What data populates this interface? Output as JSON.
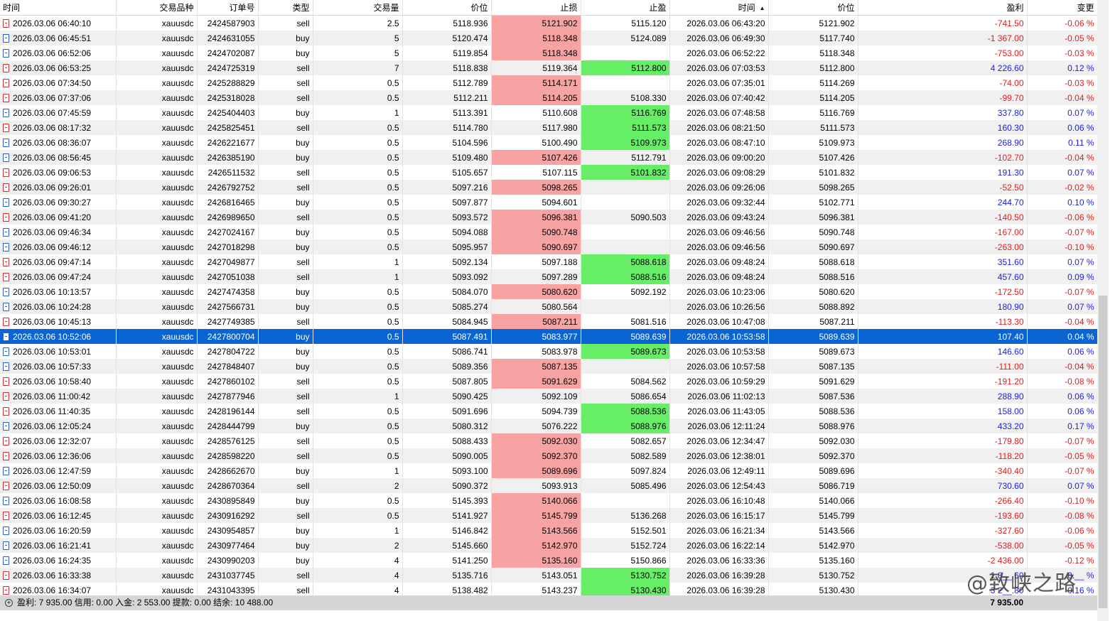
{
  "columns": [
    "时间",
    "交易品种",
    "订单号",
    "类型",
    "交易量",
    "价位",
    "止损",
    "止盈",
    "时间",
    "价位",
    "盈利",
    "变更"
  ],
  "sort_indicator": "▲",
  "colors": {
    "selected": "#0a64d2",
    "sl_hit": "#f8a3a3",
    "tp_hit": "#66ee66",
    "negative": "#e11d1d",
    "positive": "#1d1de1"
  },
  "rows": [
    {
      "time": "2026.03.06 06:40:10",
      "symbol": "xauusdc",
      "ticket": "2424587903",
      "type": "sell",
      "volume": "2.5",
      "price": "5118.936",
      "sl": "5121.902",
      "tp": "5115.120",
      "close_time": "2026.03.06 06:43:20",
      "close_price": "5121.902",
      "profit": "-741.50",
      "change": "-0.06 %",
      "hit": "sl"
    },
    {
      "time": "2026.03.06 06:45:51",
      "symbol": "xauusdc",
      "ticket": "2424631055",
      "type": "buy",
      "volume": "5",
      "price": "5120.474",
      "sl": "5118.348",
      "tp": "5124.089",
      "close_time": "2026.03.06 06:49:30",
      "close_price": "5117.740",
      "profit": "-1 367.00",
      "change": "-0.05 %",
      "hit": "sl"
    },
    {
      "time": "2026.03.06 06:52:06",
      "symbol": "xauusdc",
      "ticket": "2424702087",
      "type": "buy",
      "volume": "5",
      "price": "5119.854",
      "sl": "5118.348",
      "tp": "",
      "close_time": "2026.03.06 06:52:22",
      "close_price": "5118.348",
      "profit": "-753.00",
      "change": "-0.03 %",
      "hit": "sl"
    },
    {
      "time": "2026.03.06 06:53:25",
      "symbol": "xauusdc",
      "ticket": "2424725319",
      "type": "sell",
      "volume": "7",
      "price": "5118.838",
      "sl": "5119.364",
      "tp": "5112.800",
      "close_time": "2026.03.06 07:03:53",
      "close_price": "5112.800",
      "profit": "4 226.60",
      "change": "0.12 %",
      "hit": "tp"
    },
    {
      "time": "2026.03.06 07:34:50",
      "symbol": "xauusdc",
      "ticket": "2425288829",
      "type": "sell",
      "volume": "0.5",
      "price": "5112.789",
      "sl": "5114.171",
      "tp": "",
      "close_time": "2026.03.06 07:35:01",
      "close_price": "5114.269",
      "profit": "-74.00",
      "change": "-0.03 %",
      "hit": "sl"
    },
    {
      "time": "2026.03.06 07:37:06",
      "symbol": "xauusdc",
      "ticket": "2425318028",
      "type": "sell",
      "volume": "0.5",
      "price": "5112.211",
      "sl": "5114.205",
      "tp": "5108.330",
      "close_time": "2026.03.06 07:40:42",
      "close_price": "5114.205",
      "profit": "-99.70",
      "change": "-0.04 %",
      "hit": "sl"
    },
    {
      "time": "2026.03.06 07:45:59",
      "symbol": "xauusdc",
      "ticket": "2425404403",
      "type": "buy",
      "volume": "1",
      "price": "5113.391",
      "sl": "5110.608",
      "tp": "5116.769",
      "close_time": "2026.03.06 07:48:58",
      "close_price": "5116.769",
      "profit": "337.80",
      "change": "0.07 %",
      "hit": "tp"
    },
    {
      "time": "2026.03.06 08:17:32",
      "symbol": "xauusdc",
      "ticket": "2425825451",
      "type": "sell",
      "volume": "0.5",
      "price": "5114.780",
      "sl": "5117.980",
      "tp": "5111.573",
      "close_time": "2026.03.06 08:21:50",
      "close_price": "5111.573",
      "profit": "160.30",
      "change": "0.06 %",
      "hit": "tp"
    },
    {
      "time": "2026.03.06 08:36:07",
      "symbol": "xauusdc",
      "ticket": "2426221677",
      "type": "buy",
      "volume": "0.5",
      "price": "5104.596",
      "sl": "5100.490",
      "tp": "5109.973",
      "close_time": "2026.03.06 08:47:10",
      "close_price": "5109.973",
      "profit": "268.90",
      "change": "0.11 %",
      "hit": "tp"
    },
    {
      "time": "2026.03.06 08:56:45",
      "symbol": "xauusdc",
      "ticket": "2426385190",
      "type": "buy",
      "volume": "0.5",
      "price": "5109.480",
      "sl": "5107.426",
      "tp": "5112.791",
      "close_time": "2026.03.06 09:00:20",
      "close_price": "5107.426",
      "profit": "-102.70",
      "change": "-0.04 %",
      "hit": "sl"
    },
    {
      "time": "2026.03.06 09:06:53",
      "symbol": "xauusdc",
      "ticket": "2426511532",
      "type": "sell",
      "volume": "0.5",
      "price": "5105.657",
      "sl": "5107.115",
      "tp": "5101.832",
      "close_time": "2026.03.06 09:08:29",
      "close_price": "5101.832",
      "profit": "191.30",
      "change": "0.07 %",
      "hit": "tp"
    },
    {
      "time": "2026.03.06 09:26:01",
      "symbol": "xauusdc",
      "ticket": "2426792752",
      "type": "sell",
      "volume": "0.5",
      "price": "5097.216",
      "sl": "5098.265",
      "tp": "",
      "close_time": "2026.03.06 09:26:06",
      "close_price": "5098.265",
      "profit": "-52.50",
      "change": "-0.02 %",
      "hit": "sl"
    },
    {
      "time": "2026.03.06 09:30:27",
      "symbol": "xauusdc",
      "ticket": "2426816465",
      "type": "buy",
      "volume": "0.5",
      "price": "5097.877",
      "sl": "5094.601",
      "tp": "",
      "close_time": "2026.03.06 09:32:44",
      "close_price": "5102.771",
      "profit": "244.70",
      "change": "0.10 %",
      "hit": ""
    },
    {
      "time": "2026.03.06 09:41:20",
      "symbol": "xauusdc",
      "ticket": "2426989650",
      "type": "sell",
      "volume": "0.5",
      "price": "5093.572",
      "sl": "5096.381",
      "tp": "5090.503",
      "close_time": "2026.03.06 09:43:24",
      "close_price": "5096.381",
      "profit": "-140.50",
      "change": "-0.06 %",
      "hit": "sl"
    },
    {
      "time": "2026.03.06 09:46:34",
      "symbol": "xauusdc",
      "ticket": "2427024167",
      "type": "buy",
      "volume": "0.5",
      "price": "5094.088",
      "sl": "5090.748",
      "tp": "",
      "close_time": "2026.03.06 09:46:56",
      "close_price": "5090.748",
      "profit": "-167.00",
      "change": "-0.07 %",
      "hit": "sl"
    },
    {
      "time": "2026.03.06 09:46:12",
      "symbol": "xauusdc",
      "ticket": "2427018298",
      "type": "buy",
      "volume": "0.5",
      "price": "5095.957",
      "sl": "5090.697",
      "tp": "",
      "close_time": "2026.03.06 09:46:56",
      "close_price": "5090.697",
      "profit": "-263.00",
      "change": "-0.10 %",
      "hit": "sl"
    },
    {
      "time": "2026.03.06 09:47:14",
      "symbol": "xauusdc",
      "ticket": "2427049877",
      "type": "sell",
      "volume": "1",
      "price": "5092.134",
      "sl": "5097.188",
      "tp": "5088.618",
      "close_time": "2026.03.06 09:48:24",
      "close_price": "5088.618",
      "profit": "351.60",
      "change": "0.07 %",
      "hit": "tp"
    },
    {
      "time": "2026.03.06 09:47:24",
      "symbol": "xauusdc",
      "ticket": "2427051038",
      "type": "sell",
      "volume": "1",
      "price": "5093.092",
      "sl": "5097.289",
      "tp": "5088.516",
      "close_time": "2026.03.06 09:48:24",
      "close_price": "5088.516",
      "profit": "457.60",
      "change": "0.09 %",
      "hit": "tp"
    },
    {
      "time": "2026.03.06 10:13:57",
      "symbol": "xauusdc",
      "ticket": "2427474358",
      "type": "buy",
      "volume": "0.5",
      "price": "5084.070",
      "sl": "5080.620",
      "tp": "5092.192",
      "close_time": "2026.03.06 10:23:06",
      "close_price": "5080.620",
      "profit": "-172.50",
      "change": "-0.07 %",
      "hit": "sl"
    },
    {
      "time": "2026.03.06 10:24:28",
      "symbol": "xauusdc",
      "ticket": "2427566731",
      "type": "buy",
      "volume": "0.5",
      "price": "5085.274",
      "sl": "5080.564",
      "tp": "",
      "close_time": "2026.03.06 10:26:56",
      "close_price": "5088.892",
      "profit": "180.90",
      "change": "0.07 %",
      "hit": ""
    },
    {
      "time": "2026.03.06 10:45:13",
      "symbol": "xauusdc",
      "ticket": "2427749385",
      "type": "sell",
      "volume": "0.5",
      "price": "5084.945",
      "sl": "5087.211",
      "tp": "5081.516",
      "close_time": "2026.03.06 10:47:08",
      "close_price": "5087.211",
      "profit": "-113.30",
      "change": "-0.04 %",
      "hit": "sl"
    },
    {
      "time": "2026.03.06 10:52:06",
      "symbol": "xauusdc",
      "ticket": "2427800704",
      "type": "buy",
      "volume": "0.5",
      "price": "5087.491",
      "sl": "5083.977",
      "tp": "5089.639",
      "close_time": "2026.03.06 10:53:58",
      "close_price": "5089.639",
      "profit": "107.40",
      "change": "0.04 %",
      "hit": "",
      "selected": true
    },
    {
      "time": "2026.03.06 10:53:01",
      "symbol": "xauusdc",
      "ticket": "2427804722",
      "type": "buy",
      "volume": "0.5",
      "price": "5086.741",
      "sl": "5083.978",
      "tp": "5089.673",
      "close_time": "2026.03.06 10:53:58",
      "close_price": "5089.673",
      "profit": "146.60",
      "change": "0.06 %",
      "hit": "tp"
    },
    {
      "time": "2026.03.06 10:57:33",
      "symbol": "xauusdc",
      "ticket": "2427848407",
      "type": "buy",
      "volume": "0.5",
      "price": "5089.356",
      "sl": "5087.135",
      "tp": "",
      "close_time": "2026.03.06 10:57:58",
      "close_price": "5087.135",
      "profit": "-111.00",
      "change": "-0.04 %",
      "hit": "sl"
    },
    {
      "time": "2026.03.06 10:58:40",
      "symbol": "xauusdc",
      "ticket": "2427860102",
      "type": "sell",
      "volume": "0.5",
      "price": "5087.805",
      "sl": "5091.629",
      "tp": "5084.562",
      "close_time": "2026.03.06 10:59:29",
      "close_price": "5091.629",
      "profit": "-191.20",
      "change": "-0.08 %",
      "hit": "sl"
    },
    {
      "time": "2026.03.06 11:00:42",
      "symbol": "xauusdc",
      "ticket": "2427877946",
      "type": "sell",
      "volume": "1",
      "price": "5090.425",
      "sl": "5092.109",
      "tp": "5086.654",
      "close_time": "2026.03.06 11:02:13",
      "close_price": "5087.536",
      "profit": "288.90",
      "change": "0.06 %",
      "hit": ""
    },
    {
      "time": "2026.03.06 11:40:35",
      "symbol": "xauusdc",
      "ticket": "2428196144",
      "type": "sell",
      "volume": "0.5",
      "price": "5091.696",
      "sl": "5094.739",
      "tp": "5088.536",
      "close_time": "2026.03.06 11:43:05",
      "close_price": "5088.536",
      "profit": "158.00",
      "change": "0.06 %",
      "hit": "tp"
    },
    {
      "time": "2026.03.06 12:05:24",
      "symbol": "xauusdc",
      "ticket": "2428444799",
      "type": "buy",
      "volume": "0.5",
      "price": "5080.312",
      "sl": "5076.222",
      "tp": "5088.976",
      "close_time": "2026.03.06 12:11:24",
      "close_price": "5088.976",
      "profit": "433.20",
      "change": "0.17 %",
      "hit": "tp"
    },
    {
      "time": "2026.03.06 12:32:07",
      "symbol": "xauusdc",
      "ticket": "2428576125",
      "type": "sell",
      "volume": "0.5",
      "price": "5088.433",
      "sl": "5092.030",
      "tp": "5082.657",
      "close_time": "2026.03.06 12:34:47",
      "close_price": "5092.030",
      "profit": "-179.80",
      "change": "-0.07 %",
      "hit": "sl"
    },
    {
      "time": "2026.03.06 12:36:06",
      "symbol": "xauusdc",
      "ticket": "2428598220",
      "type": "sell",
      "volume": "0.5",
      "price": "5090.005",
      "sl": "5092.370",
      "tp": "5082.589",
      "close_time": "2026.03.06 12:38:01",
      "close_price": "5092.370",
      "profit": "-118.20",
      "change": "-0.05 %",
      "hit": "sl"
    },
    {
      "time": "2026.03.06 12:47:59",
      "symbol": "xauusdc",
      "ticket": "2428662670",
      "type": "buy",
      "volume": "1",
      "price": "5093.100",
      "sl": "5089.696",
      "tp": "5097.824",
      "close_time": "2026.03.06 12:49:11",
      "close_price": "5089.696",
      "profit": "-340.40",
      "change": "-0.07 %",
      "hit": "sl"
    },
    {
      "time": "2026.03.06 12:50:09",
      "symbol": "xauusdc",
      "ticket": "2428670364",
      "type": "sell",
      "volume": "2",
      "price": "5090.372",
      "sl": "5093.913",
      "tp": "5085.496",
      "close_time": "2026.03.06 12:54:43",
      "close_price": "5086.719",
      "profit": "730.60",
      "change": "0.07 %",
      "hit": ""
    },
    {
      "time": "2026.03.06 16:08:58",
      "symbol": "xauusdc",
      "ticket": "2430895849",
      "type": "buy",
      "volume": "0.5",
      "price": "5145.393",
      "sl": "5140.066",
      "tp": "",
      "close_time": "2026.03.06 16:10:48",
      "close_price": "5140.066",
      "profit": "-266.40",
      "change": "-0.10 %",
      "hit": "sl"
    },
    {
      "time": "2026.03.06 16:12:45",
      "symbol": "xauusdc",
      "ticket": "2430916292",
      "type": "sell",
      "volume": "0.5",
      "price": "5141.927",
      "sl": "5145.799",
      "tp": "5136.268",
      "close_time": "2026.03.06 16:15:17",
      "close_price": "5145.799",
      "profit": "-193.60",
      "change": "-0.08 %",
      "hit": "sl"
    },
    {
      "time": "2026.03.06 16:20:59",
      "symbol": "xauusdc",
      "ticket": "2430954857",
      "type": "buy",
      "volume": "1",
      "price": "5146.842",
      "sl": "5143.566",
      "tp": "5152.501",
      "close_time": "2026.03.06 16:21:34",
      "close_price": "5143.566",
      "profit": "-327.60",
      "change": "-0.06 %",
      "hit": "sl"
    },
    {
      "time": "2026.03.06 16:21:41",
      "symbol": "xauusdc",
      "ticket": "2430977464",
      "type": "buy",
      "volume": "2",
      "price": "5145.660",
      "sl": "5142.970",
      "tp": "5152.724",
      "close_time": "2026.03.06 16:22:14",
      "close_price": "5142.970",
      "profit": "-538.00",
      "change": "-0.05 %",
      "hit": "sl"
    },
    {
      "time": "2026.03.06 16:24:35",
      "symbol": "xauusdc",
      "ticket": "2430990203",
      "type": "buy",
      "volume": "4",
      "price": "5141.250",
      "sl": "5135.160",
      "tp": "5150.866",
      "close_time": "2026.03.06 16:33:36",
      "close_price": "5135.160",
      "profit": "-2 436.00",
      "change": "-0.12 %",
      "hit": "sl"
    },
    {
      "time": "2026.03.06 16:33:38",
      "symbol": "xauusdc",
      "ticket": "2431037745",
      "type": "sell",
      "volume": "4",
      "price": "5135.716",
      "sl": "5143.051",
      "tp": "5130.752",
      "close_time": "2026.03.06 16:39:28",
      "close_price": "5130.752",
      "profit": "1 8__.60",
      "change": "0.__ %",
      "hit": "tp"
    },
    {
      "time": "2026.03.06 16:34:07",
      "symbol": "xauusdc",
      "ticket": "2431043395",
      "type": "sell",
      "volume": "4",
      "price": "5138.482",
      "sl": "5143.237",
      "tp": "5130.430",
      "close_time": "2026.03.06 16:39:28",
      "close_price": "5130.430",
      "profit": "3 2__.80",
      "change": "0.16 %",
      "hit": "tp"
    }
  ],
  "summary": {
    "text": "盈利: 7 935.00  信用: 0.00  入金: 2 553.00  提款: 0.00  结余: 10 488.00",
    "total": "7 935.00",
    "expand_icon": "plus-circle-icon"
  },
  "watermark": "@致峡之路"
}
